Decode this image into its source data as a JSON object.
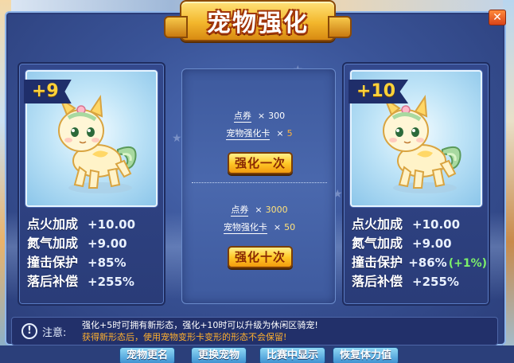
{
  "dialog": {
    "title": "宠物强化",
    "close_glyph": "✕"
  },
  "current_pet": {
    "level": "+9",
    "stats": [
      {
        "name": "点火加成",
        "value": "+10.00",
        "bonus": ""
      },
      {
        "name": "氮气加成",
        "value": "+9.00",
        "bonus": ""
      },
      {
        "name": "撞击保护",
        "value": "+85%",
        "bonus": ""
      },
      {
        "name": "落后补偿",
        "value": "+255%",
        "bonus": ""
      }
    ]
  },
  "next_pet": {
    "level": "+10",
    "stats": [
      {
        "name": "点火加成",
        "value": "+10.00",
        "bonus": ""
      },
      {
        "name": "氮气加成",
        "value": "+9.00",
        "bonus": ""
      },
      {
        "name": "撞击保护",
        "value": "+86%",
        "bonus": "(+1%)"
      },
      {
        "name": "落后补偿",
        "value": "+255%",
        "bonus": ""
      }
    ]
  },
  "enhance_once": {
    "coupon_label": "点券",
    "coupon_cost": "300",
    "card_label": "宠物强化卡",
    "card_cost": "5",
    "multiply": "×",
    "button": "强化一次"
  },
  "enhance_ten": {
    "coupon_label": "点券",
    "coupon_cost": "3000",
    "card_label": "宠物强化卡",
    "card_cost": "50",
    "multiply": "×",
    "button": "强化十次"
  },
  "notice": {
    "icon": "!",
    "label": "注意:",
    "line1": "强化+5时可拥有新形态，强化+10时可以升级为休闲区骑宠!",
    "line2": "获得新形态后，使用宠物变形卡变形的形态不会保留!"
  },
  "background_buttons": [
    "宠物更名",
    "更换宠物",
    "比赛中显示",
    "恢复体力值"
  ],
  "colors": {
    "accent_gold": "#ffc928",
    "stat_bonus_green": "#7cf06a",
    "warning_orange": "#ffb02e",
    "panel_blue": "#2a3c78"
  },
  "icons": {
    "pet": "cream-pony-pet-icon",
    "notice": "exclamation-circle-icon",
    "close": "close-icon"
  }
}
